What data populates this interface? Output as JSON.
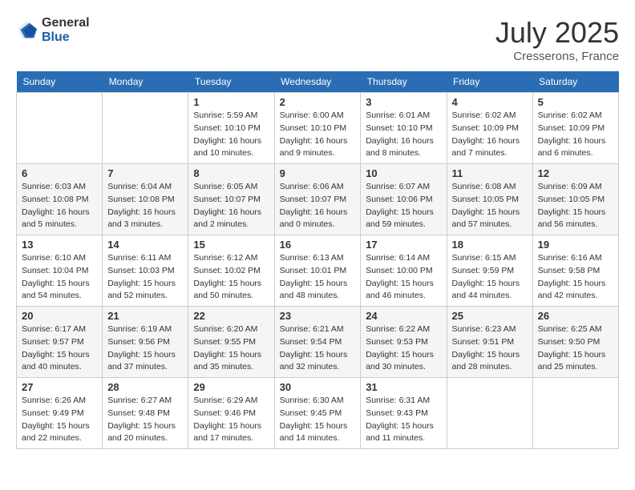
{
  "header": {
    "logo_general": "General",
    "logo_blue": "Blue",
    "month_year": "July 2025",
    "location": "Cresserons, France"
  },
  "weekdays": [
    "Sunday",
    "Monday",
    "Tuesday",
    "Wednesday",
    "Thursday",
    "Friday",
    "Saturday"
  ],
  "weeks": [
    [
      {
        "day": "",
        "sunrise": "",
        "sunset": "",
        "daylight": ""
      },
      {
        "day": "",
        "sunrise": "",
        "sunset": "",
        "daylight": ""
      },
      {
        "day": "1",
        "sunrise": "Sunrise: 5:59 AM",
        "sunset": "Sunset: 10:10 PM",
        "daylight": "Daylight: 16 hours and 10 minutes."
      },
      {
        "day": "2",
        "sunrise": "Sunrise: 6:00 AM",
        "sunset": "Sunset: 10:10 PM",
        "daylight": "Daylight: 16 hours and 9 minutes."
      },
      {
        "day": "3",
        "sunrise": "Sunrise: 6:01 AM",
        "sunset": "Sunset: 10:10 PM",
        "daylight": "Daylight: 16 hours and 8 minutes."
      },
      {
        "day": "4",
        "sunrise": "Sunrise: 6:02 AM",
        "sunset": "Sunset: 10:09 PM",
        "daylight": "Daylight: 16 hours and 7 minutes."
      },
      {
        "day": "5",
        "sunrise": "Sunrise: 6:02 AM",
        "sunset": "Sunset: 10:09 PM",
        "daylight": "Daylight: 16 hours and 6 minutes."
      }
    ],
    [
      {
        "day": "6",
        "sunrise": "Sunrise: 6:03 AM",
        "sunset": "Sunset: 10:08 PM",
        "daylight": "Daylight: 16 hours and 5 minutes."
      },
      {
        "day": "7",
        "sunrise": "Sunrise: 6:04 AM",
        "sunset": "Sunset: 10:08 PM",
        "daylight": "Daylight: 16 hours and 3 minutes."
      },
      {
        "day": "8",
        "sunrise": "Sunrise: 6:05 AM",
        "sunset": "Sunset: 10:07 PM",
        "daylight": "Daylight: 16 hours and 2 minutes."
      },
      {
        "day": "9",
        "sunrise": "Sunrise: 6:06 AM",
        "sunset": "Sunset: 10:07 PM",
        "daylight": "Daylight: 16 hours and 0 minutes."
      },
      {
        "day": "10",
        "sunrise": "Sunrise: 6:07 AM",
        "sunset": "Sunset: 10:06 PM",
        "daylight": "Daylight: 15 hours and 59 minutes."
      },
      {
        "day": "11",
        "sunrise": "Sunrise: 6:08 AM",
        "sunset": "Sunset: 10:05 PM",
        "daylight": "Daylight: 15 hours and 57 minutes."
      },
      {
        "day": "12",
        "sunrise": "Sunrise: 6:09 AM",
        "sunset": "Sunset: 10:05 PM",
        "daylight": "Daylight: 15 hours and 56 minutes."
      }
    ],
    [
      {
        "day": "13",
        "sunrise": "Sunrise: 6:10 AM",
        "sunset": "Sunset: 10:04 PM",
        "daylight": "Daylight: 15 hours and 54 minutes."
      },
      {
        "day": "14",
        "sunrise": "Sunrise: 6:11 AM",
        "sunset": "Sunset: 10:03 PM",
        "daylight": "Daylight: 15 hours and 52 minutes."
      },
      {
        "day": "15",
        "sunrise": "Sunrise: 6:12 AM",
        "sunset": "Sunset: 10:02 PM",
        "daylight": "Daylight: 15 hours and 50 minutes."
      },
      {
        "day": "16",
        "sunrise": "Sunrise: 6:13 AM",
        "sunset": "Sunset: 10:01 PM",
        "daylight": "Daylight: 15 hours and 48 minutes."
      },
      {
        "day": "17",
        "sunrise": "Sunrise: 6:14 AM",
        "sunset": "Sunset: 10:00 PM",
        "daylight": "Daylight: 15 hours and 46 minutes."
      },
      {
        "day": "18",
        "sunrise": "Sunrise: 6:15 AM",
        "sunset": "Sunset: 9:59 PM",
        "daylight": "Daylight: 15 hours and 44 minutes."
      },
      {
        "day": "19",
        "sunrise": "Sunrise: 6:16 AM",
        "sunset": "Sunset: 9:58 PM",
        "daylight": "Daylight: 15 hours and 42 minutes."
      }
    ],
    [
      {
        "day": "20",
        "sunrise": "Sunrise: 6:17 AM",
        "sunset": "Sunset: 9:57 PM",
        "daylight": "Daylight: 15 hours and 40 minutes."
      },
      {
        "day": "21",
        "sunrise": "Sunrise: 6:19 AM",
        "sunset": "Sunset: 9:56 PM",
        "daylight": "Daylight: 15 hours and 37 minutes."
      },
      {
        "day": "22",
        "sunrise": "Sunrise: 6:20 AM",
        "sunset": "Sunset: 9:55 PM",
        "daylight": "Daylight: 15 hours and 35 minutes."
      },
      {
        "day": "23",
        "sunrise": "Sunrise: 6:21 AM",
        "sunset": "Sunset: 9:54 PM",
        "daylight": "Daylight: 15 hours and 32 minutes."
      },
      {
        "day": "24",
        "sunrise": "Sunrise: 6:22 AM",
        "sunset": "Sunset: 9:53 PM",
        "daylight": "Daylight: 15 hours and 30 minutes."
      },
      {
        "day": "25",
        "sunrise": "Sunrise: 6:23 AM",
        "sunset": "Sunset: 9:51 PM",
        "daylight": "Daylight: 15 hours and 28 minutes."
      },
      {
        "day": "26",
        "sunrise": "Sunrise: 6:25 AM",
        "sunset": "Sunset: 9:50 PM",
        "daylight": "Daylight: 15 hours and 25 minutes."
      }
    ],
    [
      {
        "day": "27",
        "sunrise": "Sunrise: 6:26 AM",
        "sunset": "Sunset: 9:49 PM",
        "daylight": "Daylight: 15 hours and 22 minutes."
      },
      {
        "day": "28",
        "sunrise": "Sunrise: 6:27 AM",
        "sunset": "Sunset: 9:48 PM",
        "daylight": "Daylight: 15 hours and 20 minutes."
      },
      {
        "day": "29",
        "sunrise": "Sunrise: 6:29 AM",
        "sunset": "Sunset: 9:46 PM",
        "daylight": "Daylight: 15 hours and 17 minutes."
      },
      {
        "day": "30",
        "sunrise": "Sunrise: 6:30 AM",
        "sunset": "Sunset: 9:45 PM",
        "daylight": "Daylight: 15 hours and 14 minutes."
      },
      {
        "day": "31",
        "sunrise": "Sunrise: 6:31 AM",
        "sunset": "Sunset: 9:43 PM",
        "daylight": "Daylight: 15 hours and 11 minutes."
      },
      {
        "day": "",
        "sunrise": "",
        "sunset": "",
        "daylight": ""
      },
      {
        "day": "",
        "sunrise": "",
        "sunset": "",
        "daylight": ""
      }
    ]
  ]
}
